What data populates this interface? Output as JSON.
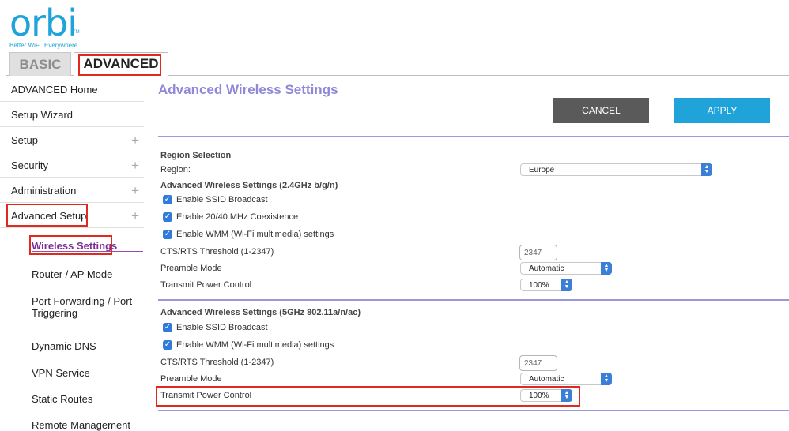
{
  "brand": {
    "logo": "orbi",
    "tm": "TM",
    "tagline": "Better WiFi. Everywhere."
  },
  "tabs": {
    "basic": "BASIC",
    "advanced": "ADVANCED"
  },
  "sidebar": {
    "items": [
      {
        "label": "ADVANCED Home"
      },
      {
        "label": "Setup Wizard"
      },
      {
        "label": "Setup"
      },
      {
        "label": "Security"
      },
      {
        "label": "Administration"
      },
      {
        "label": "Advanced Setup"
      }
    ],
    "plus": "+",
    "subitems": [
      {
        "label": "Wireless Settings"
      },
      {
        "label": "Router / AP Mode"
      },
      {
        "label": "Port Forwarding / Port Triggering"
      },
      {
        "label": "Dynamic DNS"
      },
      {
        "label": "VPN Service"
      },
      {
        "label": "Static Routes"
      },
      {
        "label": "Remote Management"
      }
    ]
  },
  "main": {
    "title": "Advanced Wireless Settings",
    "cancel_label": "CANCEL",
    "apply_label": "APPLY",
    "region": {
      "heading": "Region Selection",
      "label": "Region:",
      "value": "Europe"
    },
    "band24": {
      "heading": "Advanced Wireless Settings (2.4GHz b/g/n)",
      "enable_ssid": "Enable SSID Broadcast",
      "coexistence": "Enable 20/40 MHz Coexistence",
      "wmm": "Enable WMM (Wi-Fi multimedia) settings",
      "cts_label": "CTS/RTS Threshold (1-2347)",
      "cts_value": "2347",
      "preamble_label": "Preamble Mode",
      "preamble_value": "Automatic",
      "power_label": "Transmit Power Control",
      "power_value": "100%"
    },
    "band5": {
      "heading": "Advanced Wireless Settings (5GHz 802.11a/n/ac)",
      "enable_ssid": "Enable SSID Broadcast",
      "wmm": "Enable WMM (Wi-Fi multimedia) settings",
      "cts_label": "CTS/RTS Threshold (1-2347)",
      "cts_value": "2347",
      "preamble_label": "Preamble Mode",
      "preamble_value": "Automatic",
      "power_label": "Transmit Power Control",
      "power_value": "100%"
    }
  },
  "icons": {
    "check": "checkmark-icon",
    "select_arrows": "up-down-arrows-icon",
    "expand": "plus-icon"
  },
  "colors": {
    "brand": "#1fa3d8",
    "accent_purple": "#8f88d8",
    "highlight": "#e02a1e",
    "checkbox": "#2f7bd9"
  }
}
